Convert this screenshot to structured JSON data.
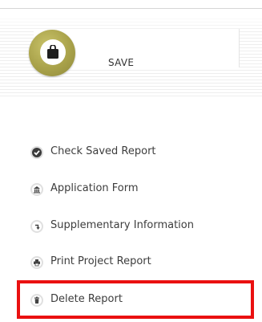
{
  "save": {
    "label": "SAVE",
    "icon": "briefcase-icon",
    "accent_color": "#a9a24a"
  },
  "menu": {
    "items": [
      {
        "label": "Check Saved Report",
        "icon": "check-circle-icon"
      },
      {
        "label": "Application Form",
        "icon": "bank-icon"
      },
      {
        "label": "Supplementary Information",
        "icon": "return-arrow-icon"
      },
      {
        "label": "Print Project Report",
        "icon": "printer-icon"
      },
      {
        "label": "Delete Report",
        "icon": "trash-icon"
      }
    ]
  },
  "highlight": {
    "target": "Delete Report",
    "color": "#ea1010"
  }
}
